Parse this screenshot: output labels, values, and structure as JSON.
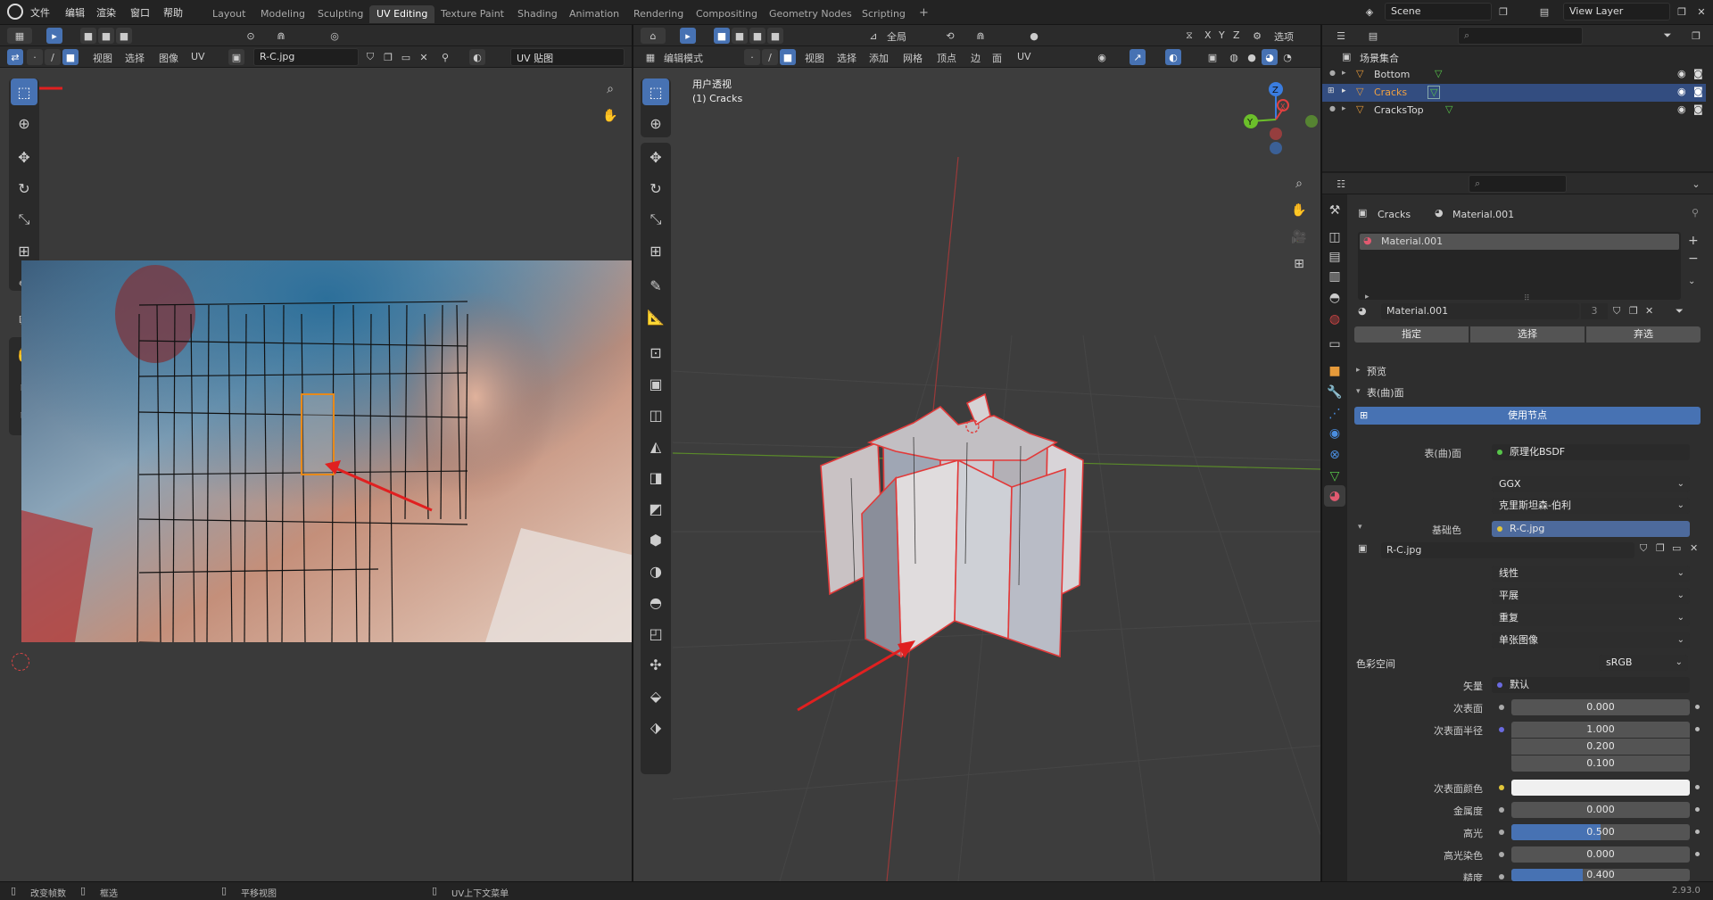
{
  "app": {
    "version": "2.93.0"
  },
  "topbar": {
    "menus": [
      "文件",
      "编辑",
      "渲染",
      "窗口",
      "帮助"
    ],
    "workspaces": [
      "Layout",
      "Modeling",
      "Sculpting",
      "UV Editing",
      "Texture Paint",
      "Shading",
      "Animation",
      "Rendering",
      "Compositing",
      "Geometry Nodes",
      "Scripting"
    ],
    "active_workspace": "UV Editing",
    "add_workspace": "+",
    "scene_label": "Scene",
    "view_layer_label": "View Layer"
  },
  "uv_editor": {
    "menus": [
      "视图",
      "选择",
      "图像",
      "UV"
    ],
    "image_name": "R-C.jpg",
    "uv_map_label": "UV 贴图"
  },
  "viewport": {
    "mode_label": "编辑模式",
    "menus": [
      "视图",
      "选择",
      "添加",
      "网格",
      "顶点",
      "边",
      "面",
      "UV"
    ],
    "transform_orientation": "全局",
    "options_label": "选项",
    "overlay_title": "用户透视",
    "overlay_object": "(1) Cracks",
    "axes": [
      "X",
      "Y",
      "Z"
    ],
    "gizmo": {
      "x": "X",
      "y": "Y",
      "z": "Z"
    }
  },
  "outliner": {
    "root": "场景集合",
    "items": [
      {
        "name": "Bottom",
        "selected": false
      },
      {
        "name": "Cracks",
        "selected": true
      },
      {
        "name": "CracksTop",
        "selected": false
      }
    ]
  },
  "properties": {
    "breadcrumb_object": "Cracks",
    "breadcrumb_material": "Material.001",
    "slot_name": "Material.001",
    "material_name": "Material.001",
    "user_count": "3",
    "slot_buttons": [
      "指定",
      "选择",
      "弃选"
    ],
    "preview_label": "预览",
    "surface_section": "表(曲)面",
    "use_nodes_button": "使用节点",
    "surface_label": "表(曲)面",
    "surface_value": "原理化BSDF",
    "distribution": "GGX",
    "subsurface_method": "克里斯坦森-伯利",
    "base_color_label": "基础色",
    "base_color_value": "R-C.jpg",
    "image_name": "R-C.jpg",
    "interpolation": "线性",
    "projection": "平展",
    "extension": "重复",
    "source": "单张图像",
    "color_space_label": "色彩空间",
    "color_space_value": "sRGB",
    "vector_label": "矢量",
    "vector_value": "默认",
    "subsurface_label": "次表面",
    "subsurface_value": "0.000",
    "subsurface_radius_label": "次表面半径",
    "subsurface_radius": [
      "1.000",
      "0.200",
      "0.100"
    ],
    "subsurface_color_label": "次表面颜色",
    "metallic_label": "金属度",
    "metallic_value": "0.000",
    "specular_label": "高光",
    "specular_value": "0.500",
    "specular_fill": 0.5,
    "specular_tint_label": "高光染色",
    "specular_tint_value": "0.000",
    "roughness_label": "糙度",
    "roughness_value": "0.400",
    "roughness_fill": 0.4
  },
  "statusbar": {
    "items": [
      "改变帧数",
      "框选",
      "平移视图",
      "UV上下文菜单"
    ],
    "version": "2.93.0"
  },
  "colors": {
    "accent": "#4772b3",
    "selected_orange": "#e88a1a",
    "annotation_red": "#e02020",
    "object_orange": "#e69a3a",
    "mesh_green": "#57c54a"
  }
}
